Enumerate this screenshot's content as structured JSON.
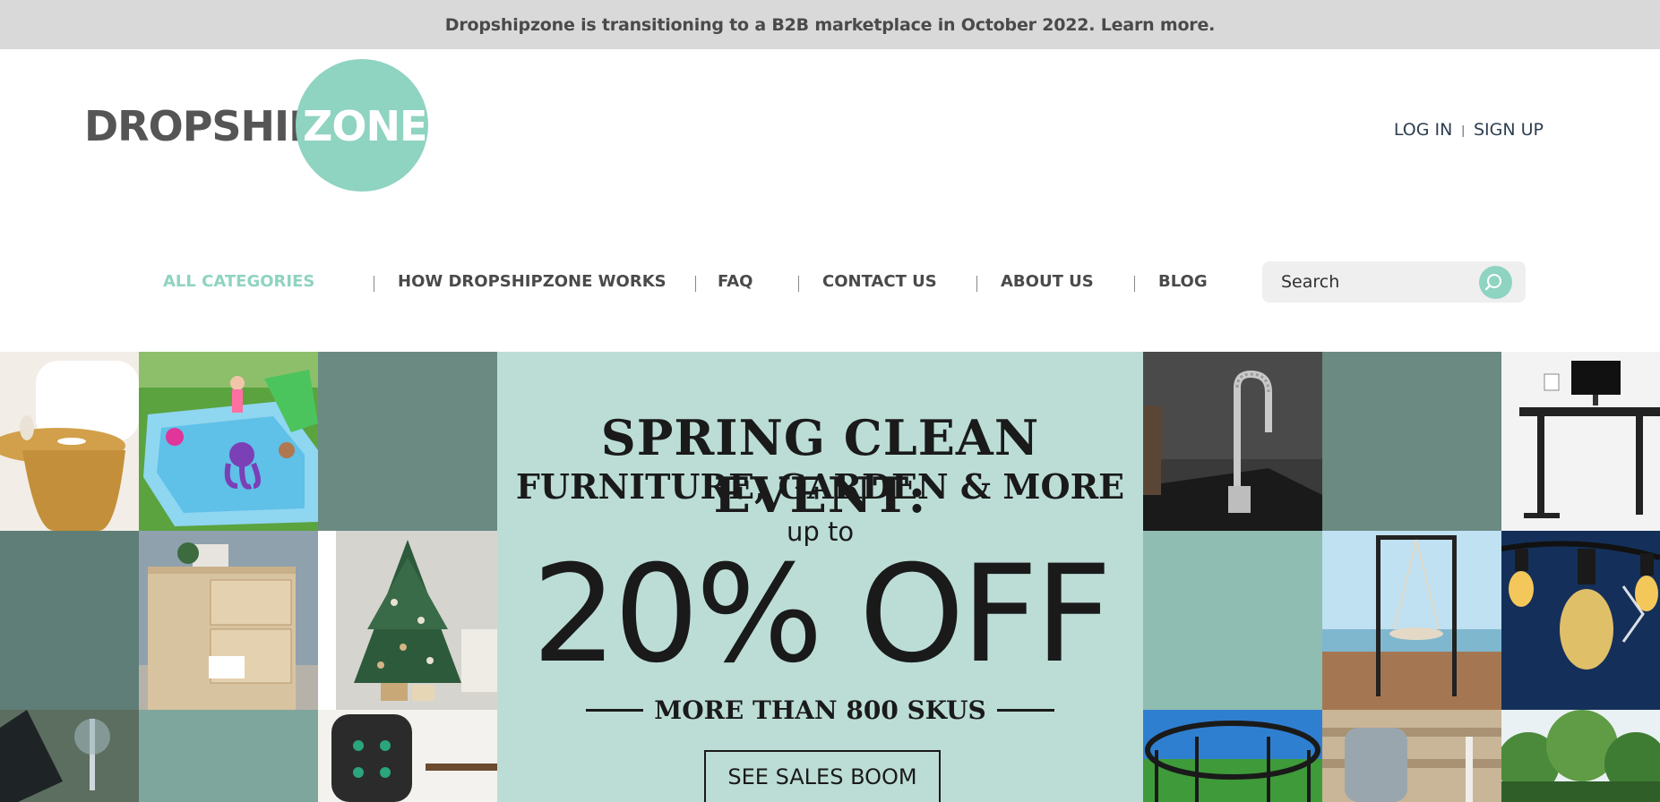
{
  "announcement": {
    "text": "Dropshipzone is transitioning to a B2B marketplace in October 2022. Learn more."
  },
  "header": {
    "logo_word": "DROPSHIP",
    "logo_zone": "ZONE.",
    "login_label": "LOG IN",
    "signup_label": "SIGN UP",
    "auth_separator": "|"
  },
  "nav": {
    "items": [
      {
        "label": "ALL CATEGORIES",
        "active": true
      },
      {
        "label": "HOW DROPSHIPZONE WORKS"
      },
      {
        "label": "FAQ"
      },
      {
        "label": "CONTACT US"
      },
      {
        "label": "ABOUT US"
      },
      {
        "label": "BLOG"
      }
    ],
    "search_placeholder": "Search"
  },
  "banner": {
    "headline": "SPRING CLEAN EVENT:",
    "subheadline": "FURNITURE, GARDEN & MORE",
    "up_to": "up to",
    "discount": "20% OFF",
    "sku_note": "MORE THAN 800 SKUS",
    "cta_label": "SEE SALES BOOM"
  },
  "colors": {
    "accent": "#8fd3c1",
    "banner_bg": "#bcddd6",
    "tile_dark": "#6a8a82",
    "tile_mid": "#8fbdb2",
    "announcement_bg": "#d9d9d9"
  }
}
